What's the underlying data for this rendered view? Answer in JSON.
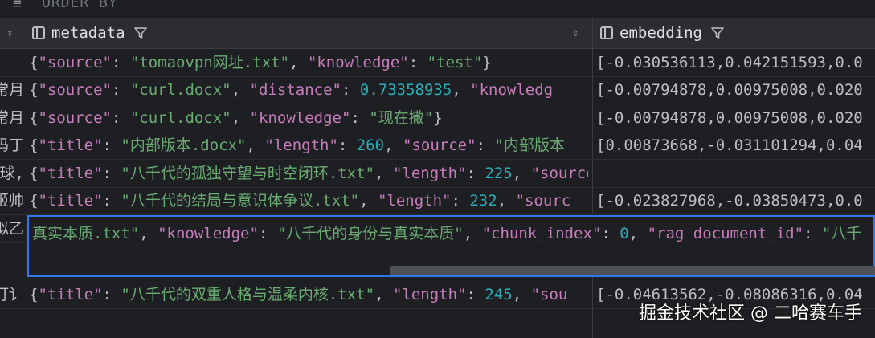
{
  "topbar": {
    "order_by_label": "ORDER BY"
  },
  "columns": [
    {
      "name": "metadata"
    },
    {
      "name": "embedding"
    }
  ],
  "rows": [
    {
      "row_head": "",
      "metadata": [
        [
          "p",
          "{"
        ],
        [
          "k",
          "\"source\""
        ],
        [
          "p",
          ": "
        ],
        [
          "s",
          "\"tomaovpn网址.txt\""
        ],
        [
          "p",
          ", "
        ],
        [
          "k",
          "\"knowledge\""
        ],
        [
          "p",
          ": "
        ],
        [
          "s",
          "\"test\""
        ],
        [
          "p",
          "}"
        ]
      ],
      "embedding": "[-0.030536113,0.042151593,0.0"
    },
    {
      "row_head": "常月",
      "metadata": [
        [
          "p",
          "{"
        ],
        [
          "k",
          "\"source\""
        ],
        [
          "p",
          ": "
        ],
        [
          "s",
          "\"curl.docx\""
        ],
        [
          "p",
          ", "
        ],
        [
          "k",
          "\"distance\""
        ],
        [
          "p",
          ": "
        ],
        [
          "n",
          "0.73358935"
        ],
        [
          "p",
          ", "
        ],
        [
          "k",
          "\"knowledg"
        ]
      ],
      "embedding": "[-0.00794878,0.00975008,0.020"
    },
    {
      "row_head": "常月",
      "metadata": [
        [
          "p",
          "{"
        ],
        [
          "k",
          "\"source\""
        ],
        [
          "p",
          ": "
        ],
        [
          "s",
          "\"curl.docx\""
        ],
        [
          "p",
          ", "
        ],
        [
          "k",
          "\"knowledge\""
        ],
        [
          "p",
          ": "
        ],
        [
          "s",
          "\"现在撒\""
        ],
        [
          "p",
          "}"
        ]
      ],
      "embedding": "[-0.00794878,0.00975008,0.020"
    },
    {
      "row_head": "码丁",
      "metadata": [
        [
          "p",
          "{"
        ],
        [
          "k",
          "\"title\""
        ],
        [
          "p",
          ": "
        ],
        [
          "s",
          "\"内部版本.docx\""
        ],
        [
          "p",
          ", "
        ],
        [
          "k",
          "\"length\""
        ],
        [
          "p",
          ": "
        ],
        [
          "n",
          "260"
        ],
        [
          "p",
          ", "
        ],
        [
          "k",
          "\"source\""
        ],
        [
          "p",
          ": "
        ],
        [
          "s",
          "\"内部版本"
        ]
      ],
      "embedding": "[0.00873668,-0.031101294,0.04"
    },
    {
      "row_head": "球,",
      "metadata": [
        [
          "p",
          "{"
        ],
        [
          "k",
          "\"title\""
        ],
        [
          "p",
          ": "
        ],
        [
          "s",
          "\"八千代的孤独守望与时空闭环.txt\""
        ],
        [
          "p",
          ", "
        ],
        [
          "k",
          "\"length\""
        ],
        [
          "p",
          ": "
        ],
        [
          "n",
          "225"
        ],
        [
          "p",
          ", "
        ],
        [
          "k",
          "\"source\""
        ],
        [
          "p",
          ": "
        ],
        [
          "s",
          "\"八千代的孤独守望与时空闭环.tx"
        ]
      ],
      "embedding": ""
    },
    {
      "row_head": "姬帅",
      "metadata": [
        [
          "p",
          "{"
        ],
        [
          "k",
          "\"title\""
        ],
        [
          "p",
          ": "
        ],
        [
          "s",
          "\"八千代的结局与意识体争议.txt\""
        ],
        [
          "p",
          ", "
        ],
        [
          "k",
          "\"length\""
        ],
        [
          "p",
          ": "
        ],
        [
          "n",
          "232"
        ],
        [
          "p",
          ", "
        ],
        [
          "k",
          "\"sourc"
        ]
      ],
      "embedding": "[-0.023827968,-0.03850473,0.0"
    },
    {
      "row_head": "拟乙",
      "metadata": [],
      "embedding": ""
    },
    {
      "row_head": "打讠",
      "metadata": [
        [
          "p",
          "{"
        ],
        [
          "k",
          "\"title\""
        ],
        [
          "p",
          ": "
        ],
        [
          "s",
          "\"八千代的双重人格与温柔内核.txt\""
        ],
        [
          "p",
          ", "
        ],
        [
          "k",
          "\"length\""
        ],
        [
          "p",
          ": "
        ],
        [
          "n",
          "245"
        ],
        [
          "p",
          ", "
        ],
        [
          "k",
          "\"sou"
        ]
      ],
      "embedding": "[-0.04613562,-0.08086316,0.04"
    }
  ],
  "editing_cell": [
    [
      "s",
      "真实本质.txt\""
    ],
    [
      "p",
      ", "
    ],
    [
      "k",
      "\"knowledge\""
    ],
    [
      "p",
      ": "
    ],
    [
      "s",
      "\"八千代的身份与真实本质\""
    ],
    [
      "p",
      ", "
    ],
    [
      "k",
      "\"chunk_index\""
    ],
    [
      "p",
      ": "
    ],
    [
      "n",
      "0"
    ],
    [
      "p",
      ", "
    ],
    [
      "k",
      "\"rag_document_id\""
    ],
    [
      "p",
      ": "
    ],
    [
      "s",
      "\"八千"
    ]
  ],
  "watermark": "掘金技术社区 @ 二哈赛车手",
  "colors": {
    "key": "#c77dbb",
    "string": "#6aab73",
    "number": "#2aacb8",
    "selection": "#3574f0",
    "background": "#1e1f22"
  }
}
